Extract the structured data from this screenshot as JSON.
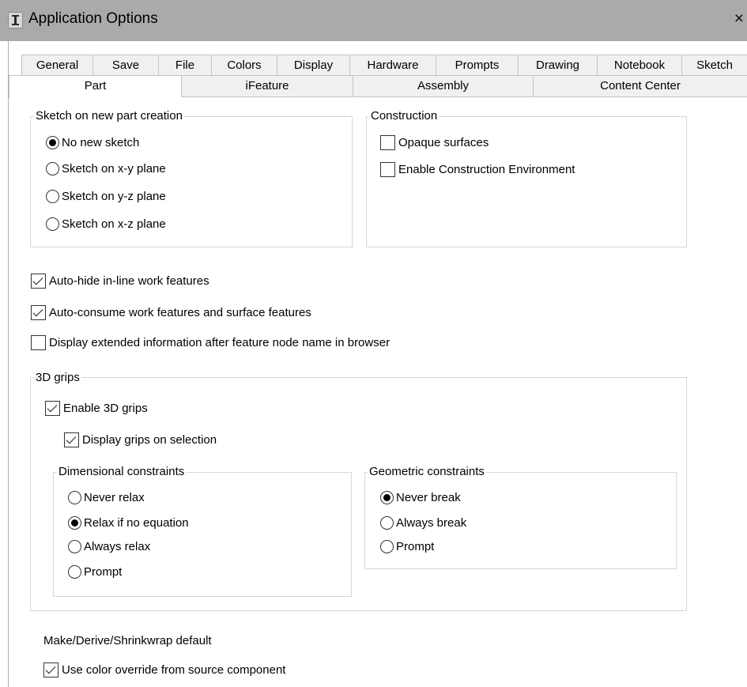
{
  "window": {
    "title": "Application Options",
    "close_glyph": "×",
    "icon": "inventor-app-icon"
  },
  "tabs_row1": [
    "General",
    "Save",
    "File",
    "Colors",
    "Display",
    "Hardware",
    "Prompts",
    "Drawing",
    "Notebook",
    "Sketch"
  ],
  "tabs_row2": [
    "Part",
    "iFeature",
    "Assembly",
    "Content Center"
  ],
  "active_tab": "Part",
  "sketch_group": {
    "legend": "Sketch on new part creation",
    "options": [
      "No new sketch",
      "Sketch on x-y plane",
      "Sketch on y-z plane",
      "Sketch on x-z plane"
    ],
    "selected": "No new sketch"
  },
  "construction_group": {
    "legend": "Construction",
    "opaque_surfaces": "Opaque surfaces",
    "enable_construction": "Enable Construction Environment"
  },
  "general_checks": {
    "auto_hide": "Auto-hide in-line work features",
    "auto_consume": "Auto-consume work features and surface features",
    "display_extended": "Display extended information after feature node name in browser"
  },
  "grips_group": {
    "legend": "3D grips",
    "enable": "Enable 3D grips",
    "display_on_selection": "Display grips on selection"
  },
  "dimensional_group": {
    "legend": "Dimensional constraints",
    "options": [
      "Never relax",
      "Relax if no equation",
      "Always relax",
      "Prompt"
    ],
    "selected": "Relax if no equation"
  },
  "geometric_group": {
    "legend": "Geometric constraints",
    "options": [
      "Never break",
      "Always break",
      "Prompt"
    ],
    "selected": "Never break"
  },
  "derive": {
    "label": "Make/Derive/Shrinkwrap default",
    "use_color_override": "Use color override from source component"
  }
}
